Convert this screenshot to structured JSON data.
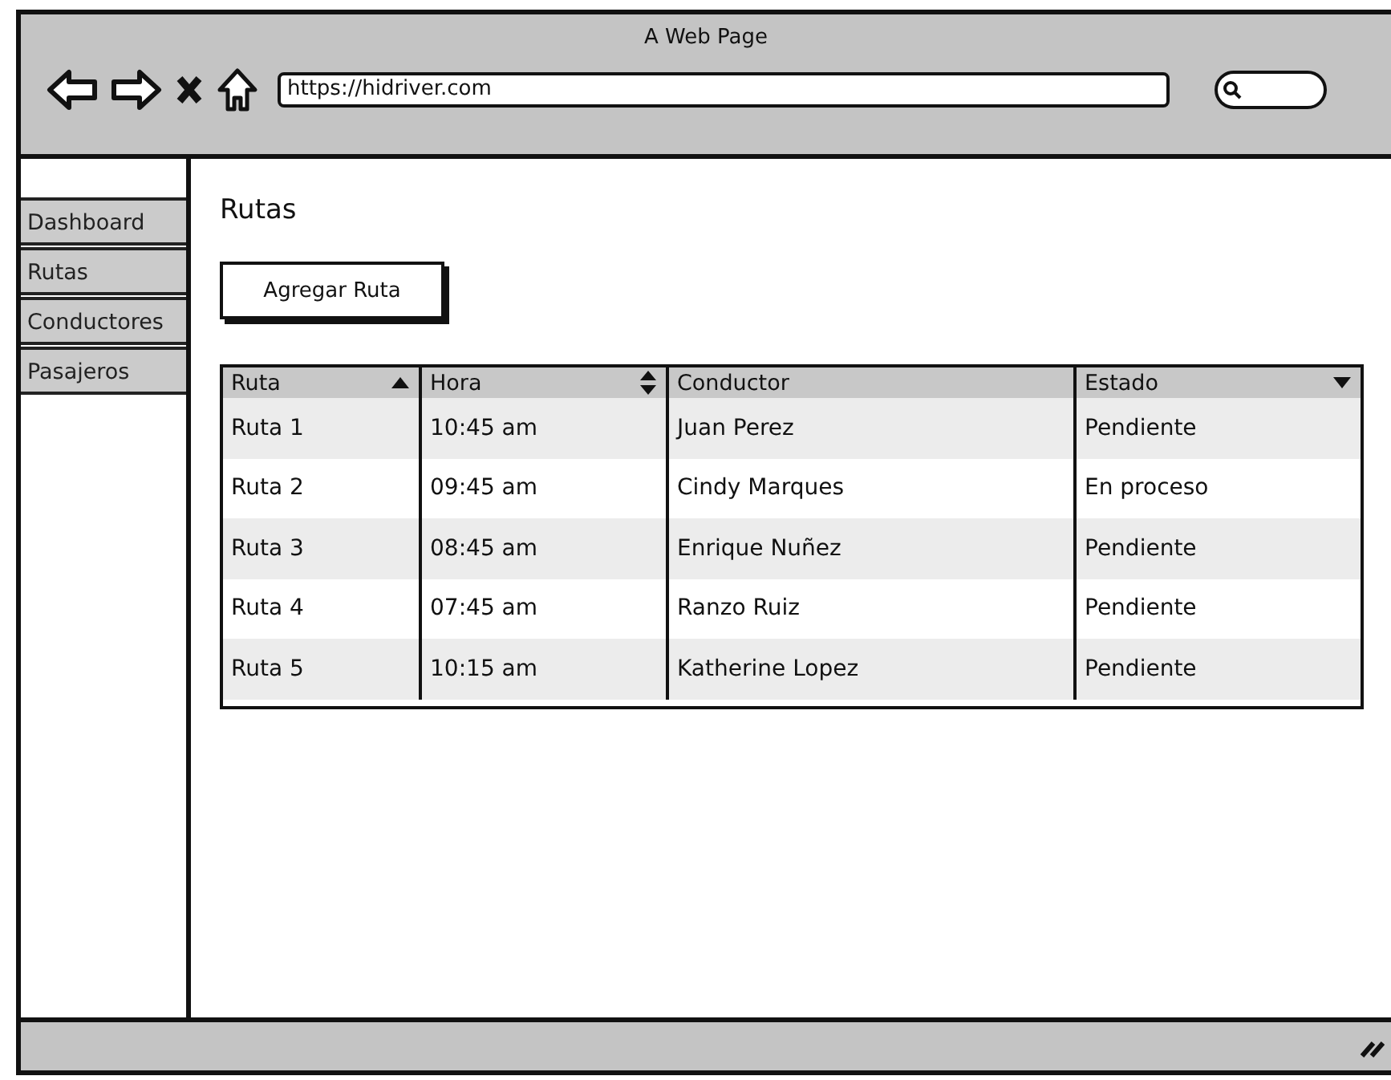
{
  "window": {
    "title": "A Web Page",
    "url": "https://hidriver.com"
  },
  "sidebar": {
    "items": [
      {
        "label": "Dashboard"
      },
      {
        "label": "Rutas"
      },
      {
        "label": "Conductores"
      },
      {
        "label": "Pasajeros"
      }
    ]
  },
  "page": {
    "heading": "Rutas",
    "button": "Agregar Ruta"
  },
  "table": {
    "columns": [
      {
        "label": "Ruta",
        "kind": "ascending"
      },
      {
        "label": "Hora",
        "kind": "sortable"
      },
      {
        "label": "Conductor",
        "kind": "plain"
      },
      {
        "label": "Estado",
        "kind": "descending"
      }
    ],
    "rows": [
      [
        "Ruta 1",
        "10:45 am",
        "Juan Perez",
        "Pendiente"
      ],
      [
        "Ruta 2",
        "09:45 am",
        "Cindy Marques",
        "En proceso"
      ],
      [
        "Ruta 3",
        "08:45 am",
        "Enrique Nuñez",
        "Pendiente"
      ],
      [
        "Ruta 4",
        "07:45 am",
        "Ranzo Ruiz",
        "Pendiente"
      ],
      [
        "Ruta 5",
        "10:15 am",
        "Katherine Lopez",
        "Pendiente"
      ]
    ]
  }
}
